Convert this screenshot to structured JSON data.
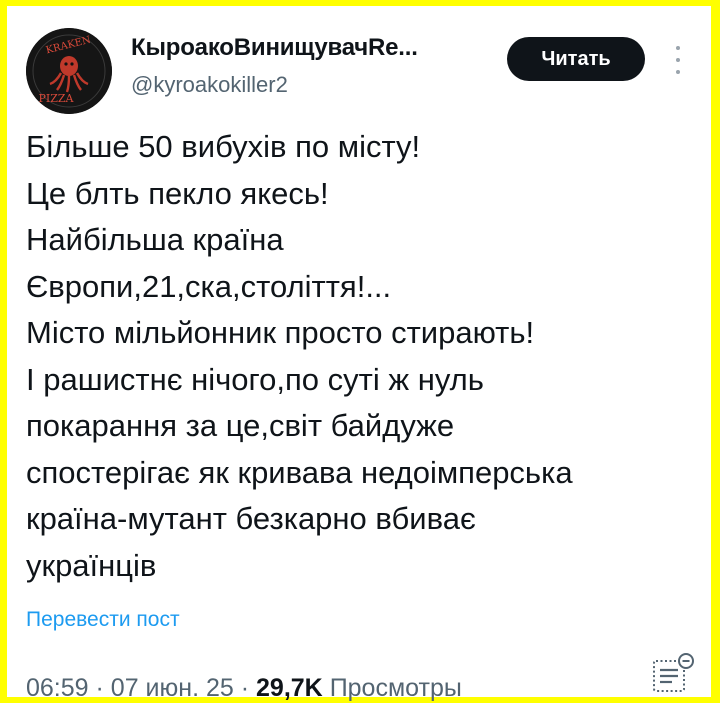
{
  "colors": {
    "background_border": "#ffff00",
    "card": "#ffffff",
    "text_primary": "#0f1419",
    "text_secondary": "#536471",
    "link": "#1d9bf0",
    "button_bg": "#0f1419",
    "button_text": "#ffffff"
  },
  "author": {
    "display_name": "КыроакоВинищувачRe...",
    "handle": "@kyroakokiller2",
    "avatar_icon": "kraken-pizza-logo",
    "avatar_logo_text_top": "KRAKEN",
    "avatar_logo_text_bottom": "PIZZA"
  },
  "follow_button": {
    "label": "Читать"
  },
  "more_button": {
    "icon": "more-vertical-icon"
  },
  "tweet": {
    "lines": [
      "Більше 50 вибухів по місту!",
      "Це блть пекло якесь!",
      "Найбільша країна",
      "Європи,21,ска,століття!...",
      "Місто мільйонник просто стирають!",
      "І рашистнє нічого,по суті ж нуль",
      "покарання за це,світ байдуже",
      "спостерігає як кривава недоімперська",
      "країна-мутант безкарно вбиває",
      "українців"
    ]
  },
  "translate_link": {
    "label": "Перевести пост"
  },
  "meta": {
    "time": "06:59",
    "separator": "·",
    "date": "07 июн. 25",
    "views_count": "29,7K",
    "views_label": "Просмотры",
    "analytics_icon": "analytics-icon"
  }
}
